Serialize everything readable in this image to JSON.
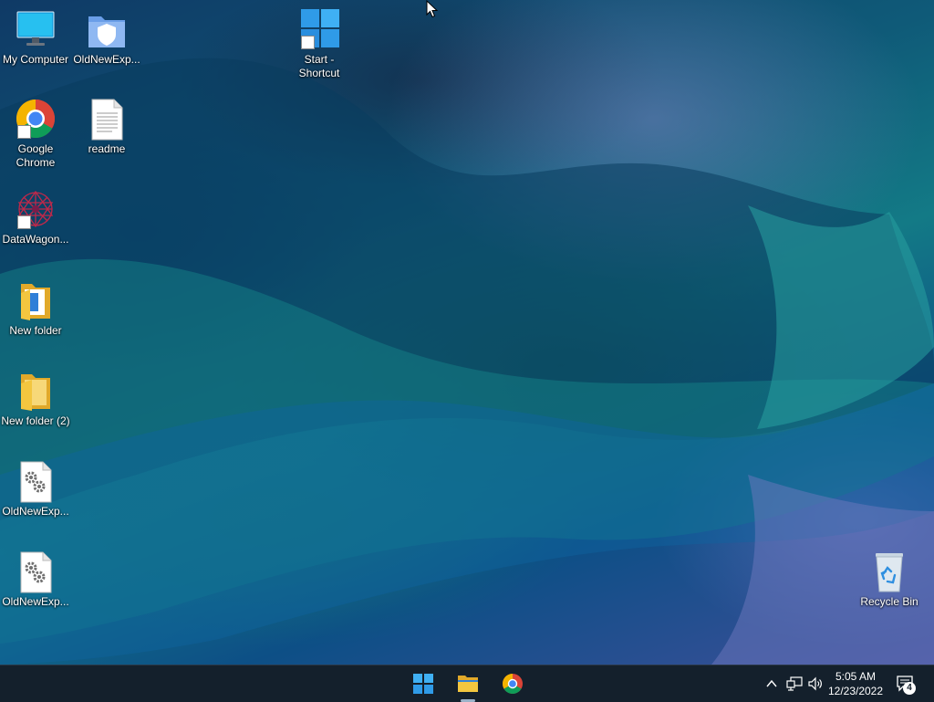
{
  "desktop_icons": [
    {
      "id": "my-computer",
      "label": "My Computer",
      "icon": "monitor-icon",
      "shortcut": false
    },
    {
      "id": "oldnewexplorer-top",
      "label": "OldNewExp...",
      "icon": "shield-folder-icon",
      "shortcut": false
    },
    {
      "id": "start-shortcut",
      "label": "Start - Shortcut",
      "icon": "windows-logo-icon",
      "shortcut": true
    },
    {
      "id": "google-chrome",
      "label": "Google Chrome",
      "icon": "chrome-icon",
      "shortcut": true
    },
    {
      "id": "readme",
      "label": "readme",
      "icon": "text-document-icon",
      "shortcut": false
    },
    {
      "id": "datawagon",
      "label": "DataWagon...",
      "icon": "datawagon-icon",
      "shortcut": true
    },
    {
      "id": "new-folder",
      "label": "New folder",
      "icon": "folder-icon",
      "shortcut": false
    },
    {
      "id": "new-folder-2",
      "label": "New folder (2)",
      "icon": "folder-icon",
      "shortcut": false
    },
    {
      "id": "oldnewexplorer-1",
      "label": "OldNewExp...",
      "icon": "settings-file-icon",
      "shortcut": false
    },
    {
      "id": "oldnewexplorer-2",
      "label": "OldNewExp...",
      "icon": "settings-file-icon",
      "shortcut": false
    },
    {
      "id": "recycle-bin",
      "label": "Recycle Bin",
      "icon": "recycle-bin-icon",
      "shortcut": false
    }
  ],
  "taskbar": {
    "pinned": [
      {
        "name": "start-button",
        "icon": "windows-logo-icon"
      },
      {
        "name": "file-explorer-button",
        "icon": "folder-icon",
        "active": true
      },
      {
        "name": "chrome-taskbar-button",
        "icon": "chrome-icon"
      }
    ],
    "tray": {
      "time": "5:05 AM",
      "date": "12/23/2022",
      "notification_count": "4"
    }
  },
  "colors": {
    "taskbar_bg": "#14202c",
    "windows_blue": "#2f9be8",
    "folder_yellow": "#f3c63f"
  }
}
